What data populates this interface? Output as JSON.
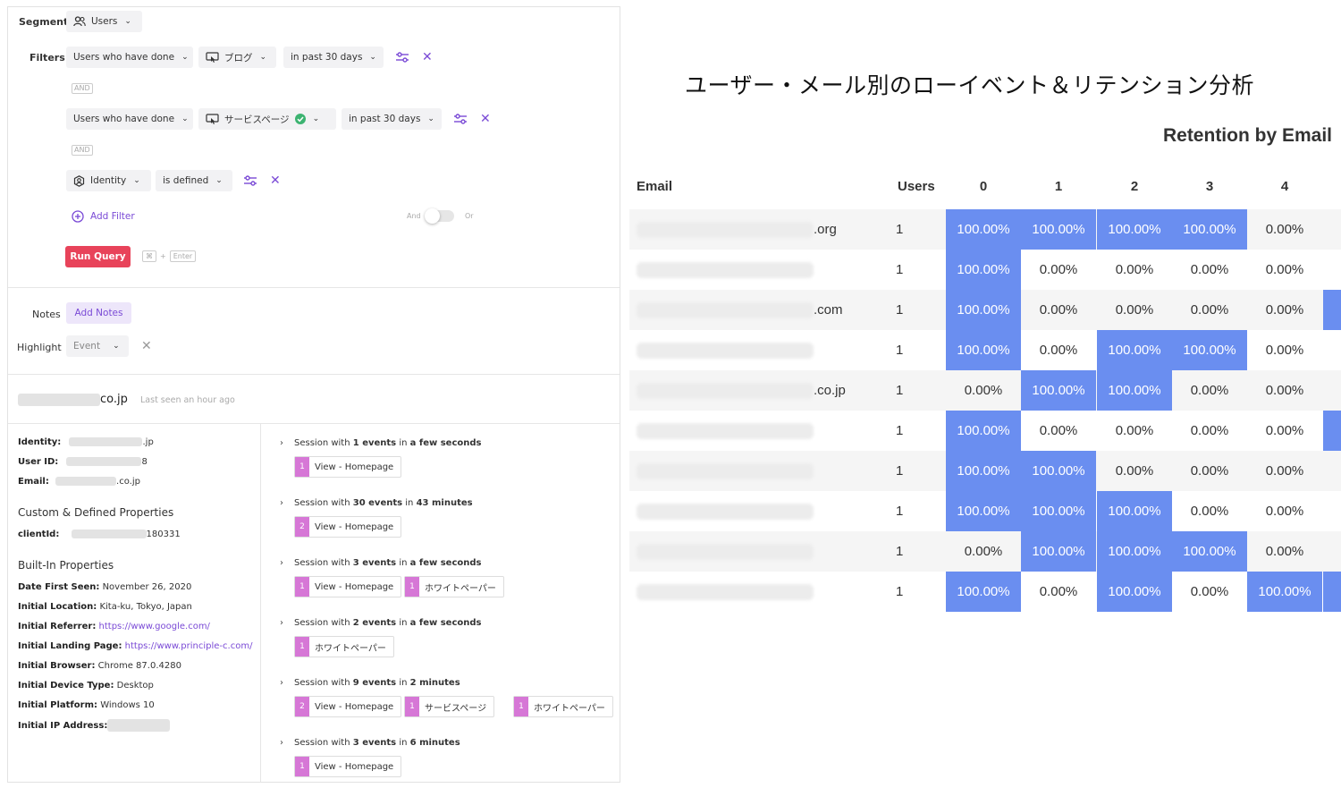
{
  "segment": {
    "label": "Segment",
    "value": "Users"
  },
  "filters": {
    "label": "Filters",
    "and_label": "AND",
    "rows": [
      {
        "subject": "Users who have done",
        "event": "ブログ",
        "time": "in past 30 days"
      },
      {
        "subject": "Users who have done",
        "event": "サービスページ",
        "time": "in past 30 days"
      },
      {
        "subject": "Identity",
        "condition": "is defined"
      }
    ],
    "add_filter": "Add Filter",
    "toggle_left": "And",
    "toggle_right": "Or",
    "run_query": "Run Query",
    "shortcut_key1": "⌘",
    "shortcut_plus": "+",
    "shortcut_key2": "Enter"
  },
  "notes": {
    "label": "Notes",
    "button": "Add Notes"
  },
  "highlight": {
    "label": "Highlight",
    "value": "Event"
  },
  "user": {
    "email_suffix": "co.jp",
    "last_seen": "Last seen an hour ago"
  },
  "identity": {
    "identity_label": "Identity:",
    "identity_suffix": ".jp",
    "userid_label": "User ID:",
    "userid_suffix": "8",
    "email_label": "Email:",
    "email_suffix": ".co.jp"
  },
  "custom": {
    "heading": "Custom & Defined Properties",
    "clientid_label": "clientId:",
    "clientid_suffix": "180331"
  },
  "builtin": {
    "heading": "Built-In Properties",
    "props": [
      {
        "label": "Date First Seen:",
        "value": "November 26, 2020"
      },
      {
        "label": "Initial Location:",
        "value": "Kita-ku, Tokyo, Japan"
      },
      {
        "label": "Initial Referrer:",
        "value": "https://www.google.com/"
      },
      {
        "label": "Initial Landing Page:",
        "value": "https://www.principle-c.com/"
      },
      {
        "label": "Initial Browser:",
        "value": "Chrome 87.0.4280"
      },
      {
        "label": "Initial Device Type:",
        "value": "Desktop"
      },
      {
        "label": "Initial Platform:",
        "value": "Windows 10"
      },
      {
        "label": "Initial IP Address:",
        "value": ""
      }
    ]
  },
  "sessions": [
    {
      "prefix": "Session with",
      "events": "1 events",
      "mid": "in",
      "duration": "a few seconds",
      "chips": [
        {
          "count": "1",
          "name": "View - Homepage"
        }
      ]
    },
    {
      "prefix": "Session with",
      "events": "30 events",
      "mid": "in",
      "duration": "43 minutes",
      "chips": [
        {
          "count": "2",
          "name": "View - Homepage"
        }
      ]
    },
    {
      "prefix": "Session with",
      "events": "3 events",
      "mid": "in",
      "duration": "a few seconds",
      "chips": [
        {
          "count": "1",
          "name": "View - Homepage"
        },
        {
          "count": "1",
          "name": "ホワイトペーパー"
        }
      ]
    },
    {
      "prefix": "Session with",
      "events": "2 events",
      "mid": "in",
      "duration": "a few seconds",
      "chips": [
        {
          "count": "1",
          "name": "ホワイトペーパー"
        }
      ]
    },
    {
      "prefix": "Session with",
      "events": "9 events",
      "mid": "in",
      "duration": "2 minutes",
      "chips": [
        {
          "count": "2",
          "name": "View - Homepage"
        },
        {
          "count": "1",
          "name": "サービスページ"
        },
        {
          "count": "1",
          "name": "ホワイトペーパー"
        }
      ]
    },
    {
      "prefix": "Session with",
      "events": "3 events",
      "mid": "in",
      "duration": "6 minutes",
      "chips": [
        {
          "count": "1",
          "name": "View - Homepage"
        }
      ]
    }
  ],
  "jp_title": "ユーザー・メール別のローイベント＆リテンション分析",
  "retention": {
    "title": "Retention by Email",
    "headers": {
      "email": "Email",
      "users": "Users",
      "periods": [
        "0",
        "1",
        "2",
        "3",
        "4"
      ]
    },
    "highlight_color": "#6a8ef0",
    "rows": [
      {
        "email_suffix": ".org",
        "users": "1",
        "values": [
          "100.00%",
          "100.00%",
          "100.00%",
          "100.00%",
          "0.00%"
        ],
        "hi": [
          true,
          true,
          true,
          true,
          false
        ],
        "edge": false
      },
      {
        "email_suffix": "",
        "users": "1",
        "values": [
          "100.00%",
          "0.00%",
          "0.00%",
          "0.00%",
          "0.00%"
        ],
        "hi": [
          true,
          false,
          false,
          false,
          false
        ],
        "edge": false
      },
      {
        "email_suffix": ".com",
        "users": "1",
        "values": [
          "100.00%",
          "0.00%",
          "0.00%",
          "0.00%",
          "0.00%"
        ],
        "hi": [
          true,
          false,
          false,
          false,
          false
        ],
        "edge": true
      },
      {
        "email_suffix": "",
        "users": "1",
        "values": [
          "100.00%",
          "0.00%",
          "100.00%",
          "100.00%",
          "0.00%"
        ],
        "hi": [
          true,
          false,
          true,
          true,
          false
        ],
        "edge": false
      },
      {
        "email_suffix": ".co.jp",
        "users": "1",
        "values": [
          "0.00%",
          "100.00%",
          "100.00%",
          "0.00%",
          "0.00%"
        ],
        "hi": [
          false,
          true,
          true,
          false,
          false
        ],
        "edge": false
      },
      {
        "email_suffix": "",
        "users": "1",
        "values": [
          "100.00%",
          "0.00%",
          "0.00%",
          "0.00%",
          "0.00%"
        ],
        "hi": [
          true,
          false,
          false,
          false,
          false
        ],
        "edge": true
      },
      {
        "email_suffix": "",
        "users": "1",
        "values": [
          "100.00%",
          "100.00%",
          "0.00%",
          "0.00%",
          "0.00%"
        ],
        "hi": [
          true,
          true,
          false,
          false,
          false
        ],
        "edge": false
      },
      {
        "email_suffix": "",
        "users": "1",
        "values": [
          "100.00%",
          "100.00%",
          "100.00%",
          "0.00%",
          "0.00%"
        ],
        "hi": [
          true,
          true,
          true,
          false,
          false
        ],
        "edge": false
      },
      {
        "email_suffix": "",
        "users": "1",
        "values": [
          "0.00%",
          "100.00%",
          "100.00%",
          "100.00%",
          "0.00%"
        ],
        "hi": [
          false,
          true,
          true,
          true,
          false
        ],
        "edge": false
      },
      {
        "email_suffix": "",
        "users": "1",
        "values": [
          "100.00%",
          "0.00%",
          "100.00%",
          "0.00%",
          "100.00%"
        ],
        "hi": [
          true,
          false,
          true,
          false,
          true
        ],
        "edge": true
      }
    ]
  }
}
